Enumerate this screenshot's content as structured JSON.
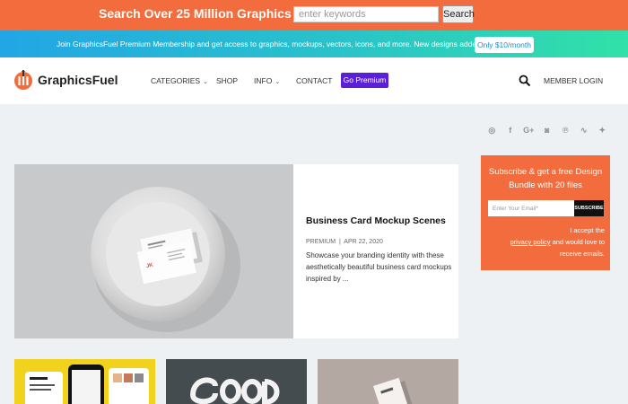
{
  "topbar": {
    "headline": "Search Over 25 Million Graphics",
    "search_placeholder": "enter keywords",
    "search_button": "Search"
  },
  "promo": {
    "text": "Join GraphicsFuel Premium Membership and get access to graphics, mockups, vectors, icons, and more. New designs added weekly!",
    "button": "Only $10/month"
  },
  "nav": {
    "logo_text": "GraphicsFuel",
    "items": [
      {
        "label": "CATEGORIES",
        "dropdown": true
      },
      {
        "label": "SHOP",
        "dropdown": false
      },
      {
        "label": "INFO",
        "dropdown": true
      },
      {
        "label": "CONTACT",
        "dropdown": false
      }
    ],
    "go_premium": "Go Premium",
    "member_login": "MEMBER LOGIN",
    "search_icon": "search-icon"
  },
  "social": [
    "dribbble-icon",
    "facebook-icon",
    "google-plus-icon",
    "instagram-icon",
    "pinterest-icon",
    "rss-icon",
    "twitter-icon"
  ],
  "featured": {
    "title": "Business Card Mockup Scenes",
    "category": "PREMIUM",
    "date": "APR 22, 2020",
    "excerpt": "Showcase your branding identity with these aesthetically beautiful business card mockups inspired by ..."
  },
  "subscribe": {
    "title": "Subscribe & get a free Design Bundle with 20 files",
    "email_placeholder": "Enter Your Email*",
    "button": "SUBSCRIBE",
    "accept_prefix": "I accept the",
    "privacy_link": "privacy policy",
    "accept_suffix": "and would love to receive emails."
  },
  "colors": {
    "accent_orange": "#f36c3d",
    "premium_purple": "#5b1fd7",
    "page_bg": "#eef1f4"
  }
}
